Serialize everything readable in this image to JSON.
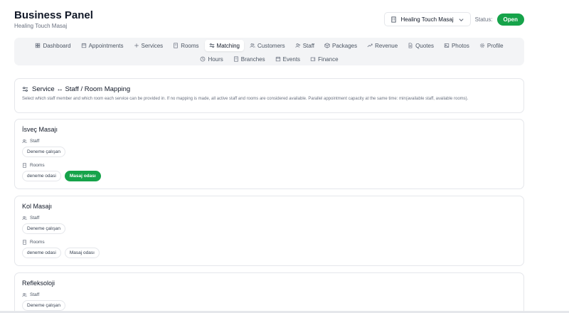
{
  "header": {
    "title": "Business Panel",
    "subtitle": "Healing Touch Masaj",
    "business_select": "Healing Touch Masaj",
    "status_label": "Status:",
    "status_value": "Open"
  },
  "nav": {
    "row1": [
      {
        "label": "Dashboard",
        "icon": "grid-icon"
      },
      {
        "label": "Appointments",
        "icon": "calendar-icon"
      },
      {
        "label": "Services",
        "icon": "plus-icon"
      },
      {
        "label": "Rooms",
        "icon": "building-icon"
      },
      {
        "label": "Matching",
        "icon": "sliders-icon",
        "active": true
      },
      {
        "label": "Customers",
        "icon": "users-icon"
      },
      {
        "label": "Staff",
        "icon": "user-plus-icon"
      },
      {
        "label": "Packages",
        "icon": "package-icon"
      },
      {
        "label": "Revenue",
        "icon": "trend-icon"
      },
      {
        "label": "Quotes",
        "icon": "file-icon"
      },
      {
        "label": "Photos",
        "icon": "image-icon"
      },
      {
        "label": "Profile",
        "icon": "gear-icon"
      }
    ],
    "row2": [
      {
        "label": "Hours",
        "icon": "clock-icon"
      },
      {
        "label": "Branches",
        "icon": "building-icon"
      },
      {
        "label": "Events",
        "icon": "calendar-icon"
      },
      {
        "label": "Finance",
        "icon": "wallet-icon"
      }
    ]
  },
  "intro": {
    "title": "Service ↔ Staff / Room Mapping",
    "description": "Select which staff member and which room each service can be provided in. If no mapping is made, all active staff and rooms are considered available. Parallel appointment capacity at the same time: min(available staff, available rooms)."
  },
  "labels": {
    "staff": "Staff",
    "rooms": "Rooms"
  },
  "services": [
    {
      "name": "İsveç Masajı",
      "staff": [
        "Deneme çalışan"
      ],
      "rooms": [
        "deneme odasi",
        "Masaj odası"
      ]
    },
    {
      "name": "Kol Masajı",
      "staff": [
        "Deneme çalışan"
      ],
      "rooms": [
        "deneme odasi",
        "Masaj odası"
      ]
    },
    {
      "name": "Refleksoloji",
      "staff": [
        "Deneme çalışan"
      ],
      "rooms": []
    }
  ],
  "colors": {
    "accent": "#16a34a",
    "nav_bg": "#f3f4f6",
    "border": "#e5e7eb"
  }
}
